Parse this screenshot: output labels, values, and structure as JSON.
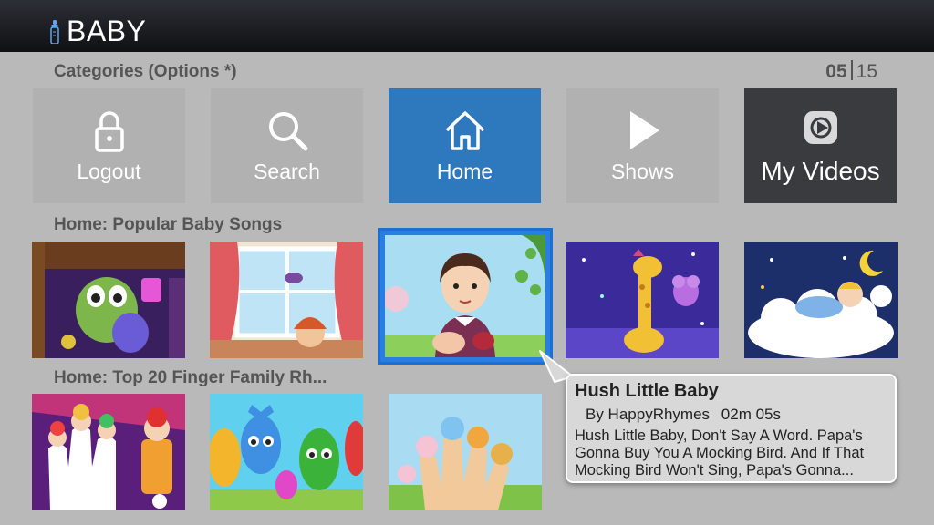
{
  "header": {
    "app_title": "BABY",
    "icon": "baby-bottle-icon"
  },
  "categories": {
    "label": "Categories (Options *)",
    "page_current": "05",
    "page_total": "15",
    "tiles": [
      {
        "label": "Logout",
        "icon": "lock-icon"
      },
      {
        "label": "Search",
        "icon": "search-icon"
      },
      {
        "label": "Home",
        "icon": "home-icon",
        "selected": true
      },
      {
        "label": "Shows",
        "icon": "play-icon"
      },
      {
        "label": "My Videos",
        "icon": "my-videos-icon"
      }
    ]
  },
  "rows": [
    {
      "label": "Home:  Popular Baby Songs",
      "thumbnails": [
        "purple-creature-scene",
        "window-room-scene",
        "hush-little-baby",
        "giraffe-night-scene",
        "sleeping-cloud-baby"
      ]
    },
    {
      "label": "Home:  Top 20 Finger Family Rh...",
      "thumbnails": [
        "clown-finger-family",
        "candy-finger-family",
        "animal-finger-family"
      ]
    }
  ],
  "tooltip": {
    "title": "Hush Little Baby",
    "author": "By HappyRhymes",
    "duration": "02m 05s",
    "description": "Hush Little Baby, Don't Say A Word. Papa's Gonna Buy You A Mocking Bird.  And If That Mocking Bird Won't Sing, Papa's Gonna..."
  },
  "colors": {
    "accent": "#2e78bd",
    "focus_border": "#2a7de1",
    "background": "#b9b9b9",
    "dark_tile": "#3a3b3e"
  }
}
